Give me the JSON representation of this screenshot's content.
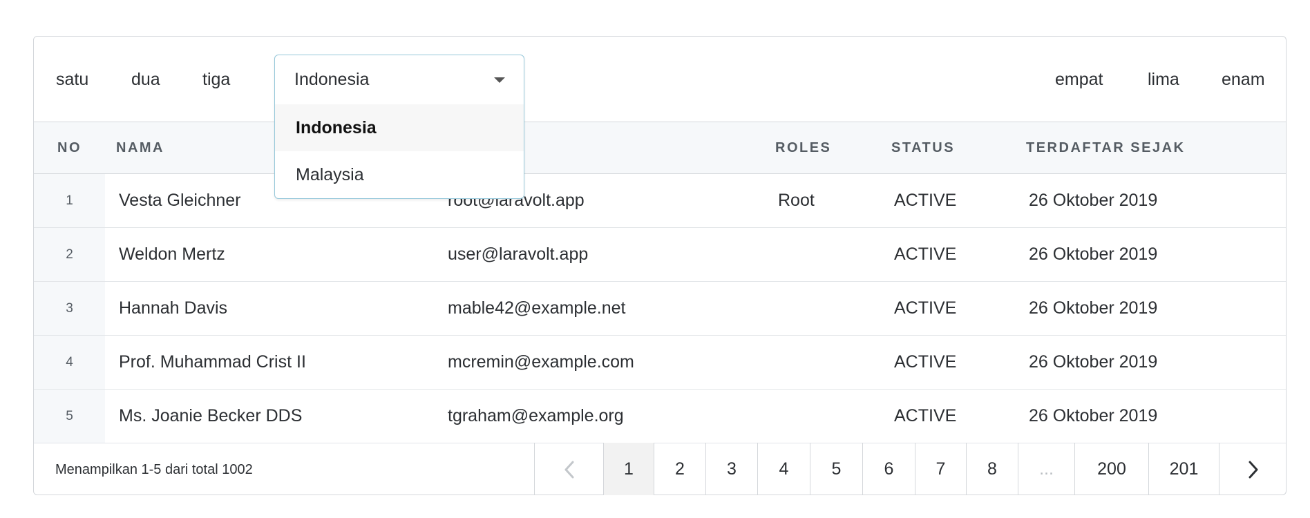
{
  "toolbar": {
    "left_links": [
      "satu",
      "dua",
      "tiga"
    ],
    "right_links": [
      "empat",
      "lima",
      "enam"
    ],
    "country_select": {
      "value": "Indonesia",
      "options": [
        "Indonesia",
        "Malaysia"
      ]
    }
  },
  "table": {
    "headers": {
      "no": "NO",
      "nama": "NAMA",
      "roles": "ROLES",
      "status": "STATUS",
      "terdaftar": "TERDAFTAR SEJAK"
    },
    "rows": [
      {
        "no": "1",
        "nama": "Vesta Gleichner",
        "email": "root@laravolt.app",
        "roles": "Root",
        "status": "ACTIVE",
        "terdaftar": "26 Oktober 2019"
      },
      {
        "no": "2",
        "nama": "Weldon Mertz",
        "email": "user@laravolt.app",
        "roles": "",
        "status": "ACTIVE",
        "terdaftar": "26 Oktober 2019"
      },
      {
        "no": "3",
        "nama": "Hannah Davis",
        "email": "mable42@example.net",
        "roles": "",
        "status": "ACTIVE",
        "terdaftar": "26 Oktober 2019"
      },
      {
        "no": "4",
        "nama": "Prof. Muhammad Crist II",
        "email": "mcremin@example.com",
        "roles": "",
        "status": "ACTIVE",
        "terdaftar": "26 Oktober 2019"
      },
      {
        "no": "5",
        "nama": "Ms. Joanie Becker DDS",
        "email": "tgraham@example.org",
        "roles": "",
        "status": "ACTIVE",
        "terdaftar": "26 Oktober 2019"
      }
    ]
  },
  "footer": {
    "info": "Menampilkan 1-5 dari total 1002",
    "pages": [
      "1",
      "2",
      "3",
      "4",
      "5",
      "6",
      "7",
      "8",
      "...",
      "200",
      "201"
    ],
    "active_page": "1",
    "prev_icon": "chevron-left-icon",
    "next_icon": "chevron-right-icon"
  },
  "colors": {
    "border": "#d4d7db",
    "header_bg": "#f6f8fa",
    "select_border": "#96c8da",
    "active_page_bg": "#f2f2f2"
  }
}
